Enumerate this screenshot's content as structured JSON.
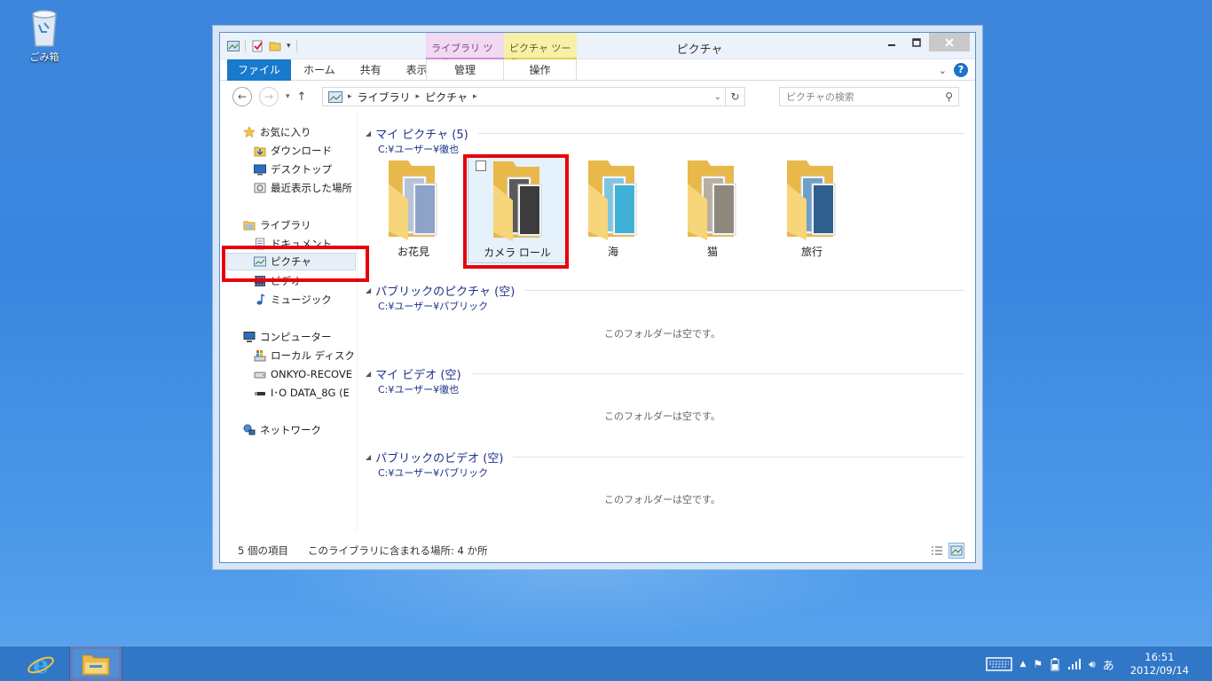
{
  "desktop": {
    "recycle_bin_label": "ごみ箱"
  },
  "window": {
    "title": "ピクチャ",
    "context_tabs": {
      "library_tools": "ライブラリ ツール",
      "picture_tools": "ピクチャ ツール"
    },
    "ribbon_tabs": {
      "file": "ファイル",
      "home": "ホーム",
      "share": "共有",
      "view": "表示",
      "manage": "管理",
      "operate": "操作"
    },
    "address": {
      "segments": [
        "ライブラリ",
        "ピクチャ"
      ]
    },
    "search": {
      "placeholder": "ピクチャの検索"
    }
  },
  "navpane": {
    "favorites": "お気に入り",
    "downloads": "ダウンロード",
    "desktop": "デスクトップ",
    "recent": "最近表示した場所",
    "libraries": "ライブラリ",
    "documents": "ドキュメント",
    "pictures": "ピクチャ",
    "videos": "ビデオ",
    "music": "ミュージック",
    "computer": "コンピューター",
    "local_disk": "ローカル ディスク (C",
    "onkyo": "ONKYO-RECOVE",
    "iodata": "I･O DATA_8G (E",
    "network": "ネットワーク"
  },
  "groups": [
    {
      "title": "マイ ピクチャ (5)",
      "path": "C:¥ユーザー¥徹也"
    },
    {
      "title": "パブリックのピクチャ (空)",
      "path": "C:¥ユーザー¥パブリック",
      "empty": "このフォルダーは空です。"
    },
    {
      "title": "マイ ビデオ (空)",
      "path": "C:¥ユーザー¥徹也",
      "empty": "このフォルダーは空です。"
    },
    {
      "title": "パブリックのビデオ (空)",
      "path": "C:¥ユーザー¥パブリック",
      "empty": "このフォルダーは空です。"
    }
  ],
  "folders": [
    {
      "name": "お花見",
      "selected": false,
      "photo_color": "#8fa3c8"
    },
    {
      "name": "カメラ ロール",
      "selected": true,
      "photo_color": "#4a4a4a"
    },
    {
      "name": "海",
      "selected": false,
      "photo_color": "#3fb0d6"
    },
    {
      "name": "猫",
      "selected": false,
      "photo_color": "#9a9488"
    },
    {
      "name": "旅行",
      "selected": false,
      "photo_color": "#3c78b0"
    }
  ],
  "status": {
    "item_count": "5 個の項目",
    "locations": "このライブラリに含まれる場所: 4 か所"
  },
  "taskbar": {
    "time": "16:51",
    "date": "2012/09/14",
    "ime": "あ"
  },
  "colors": {
    "accent": "#1979ca",
    "highlight_red": "#e8000c",
    "group_text": "#1e3287"
  }
}
